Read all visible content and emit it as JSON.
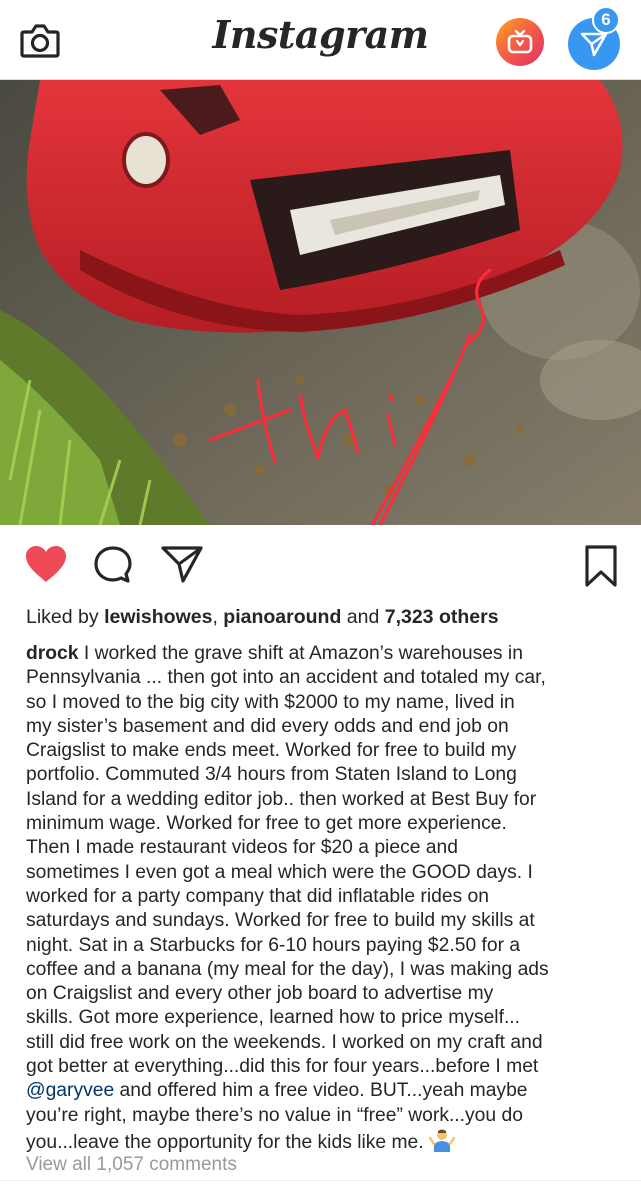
{
  "header": {
    "logo_text": "Instagram",
    "direct_badge_count": "6",
    "icons": [
      "camera-icon",
      "igtv-icon",
      "direct-message-icon"
    ]
  },
  "post": {
    "photo_overlay_handwriting": "this",
    "actions": [
      "heart-icon",
      "comment-icon",
      "share-icon",
      "bookmark-icon"
    ],
    "liked_state": true,
    "likes": {
      "prefix": "Liked by ",
      "user1": "lewishowes",
      "sep1": ", ",
      "user2": "pianoaround",
      "sep2": " and ",
      "others": "7,323 others"
    },
    "caption": {
      "username": "drock",
      "text_before_mention": " I worked the grave shift at Amazon’s warehouses in\nPennsylvania ... then got into an accident and totaled my car,\nso I moved to the big city with $2000 to my name, lived in\nmy sister’s basement and did every odds and end job on\nCraigslist to make ends meet. Worked for free to build my\nportfolio. Commuted 3/4 hours from Staten Island to Long\nIsland for a wedding editor job.. then worked at Best Buy for\nminimum wage. Worked for free to get more experience.\nThen I made restaurant videos for $20 a piece and\nsometimes I even got a meal which were the GOOD days.  I\nworked for a party company that did inflatable rides on\nsaturdays and sundays. Worked for free to build my skills at\nnight. Sat in a Starbucks for 6-10 hours paying $2.50 for a\ncoffee and a banana (my meal for the day), I was making ads\non Craigslist and every other job board to advertise my\nskills. Got more experience, learned how to price myself...\nstill did free work on the weekends. I worked on my craft and\ngot better at everything...did this for four years...before I met\n",
      "mention": "@garyvee",
      "text_after_mention": " and offered him a free video. BUT...yeah maybe\nyou’re right, maybe there’s no value in “free” work...you do\nyou...leave the opportunity for the kids like me. ",
      "emoji": "man-shrugging-emoji"
    },
    "view_comments": "View all 1,057 comments"
  },
  "colors": {
    "like_red": "#ed4956",
    "link_blue": "#003569",
    "direct_blue": "#3897f0",
    "annotation_red": "#ff2a3a",
    "muted_gray": "#999999"
  }
}
